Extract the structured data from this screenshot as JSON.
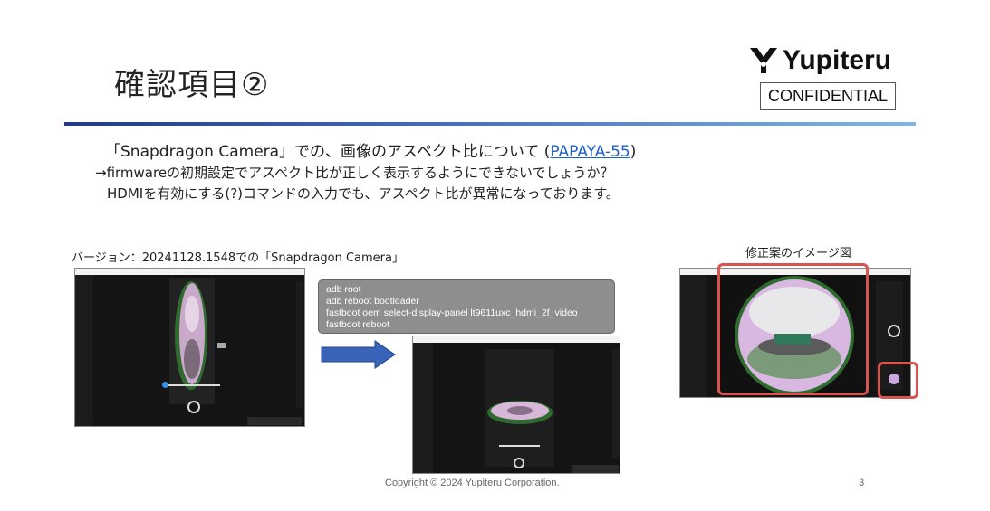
{
  "slide": {
    "title": "確認項目②",
    "logo_text": "Yupiteru",
    "confidential": "CONFIDENTIAL",
    "line1_prefix": "「Snapdragon Camera」での、画像のアスペクト比について (",
    "line1_link": "PAPAYA-55",
    "line1_suffix": ")",
    "line2": "→firmwareの初期設定でアスペクト比が正しく表示するようにできないでしょうか？",
    "line3": "HDMIを有効にする(?)コマンドの入力でも、アスペクト比が異常になっております。",
    "version_label": "バージョン：20241128.1548での「Snapdragon Camera」",
    "fix_label": "修正案のイメージ図",
    "commands": [
      "adb root",
      "adb  reboot bootloader",
      "fastboot oem select-display-panel lt9611uxc_hdmi_2f_video",
      "fastboot reboot"
    ],
    "copyright": "Copyright © 2024 Yupiteru Corporation.",
    "page_number": "3"
  },
  "colors": {
    "accent_rule": "#1f3a93",
    "link": "#1f5fc7",
    "arrow": "#3a64b8",
    "highlight_box": "#d9534f"
  }
}
